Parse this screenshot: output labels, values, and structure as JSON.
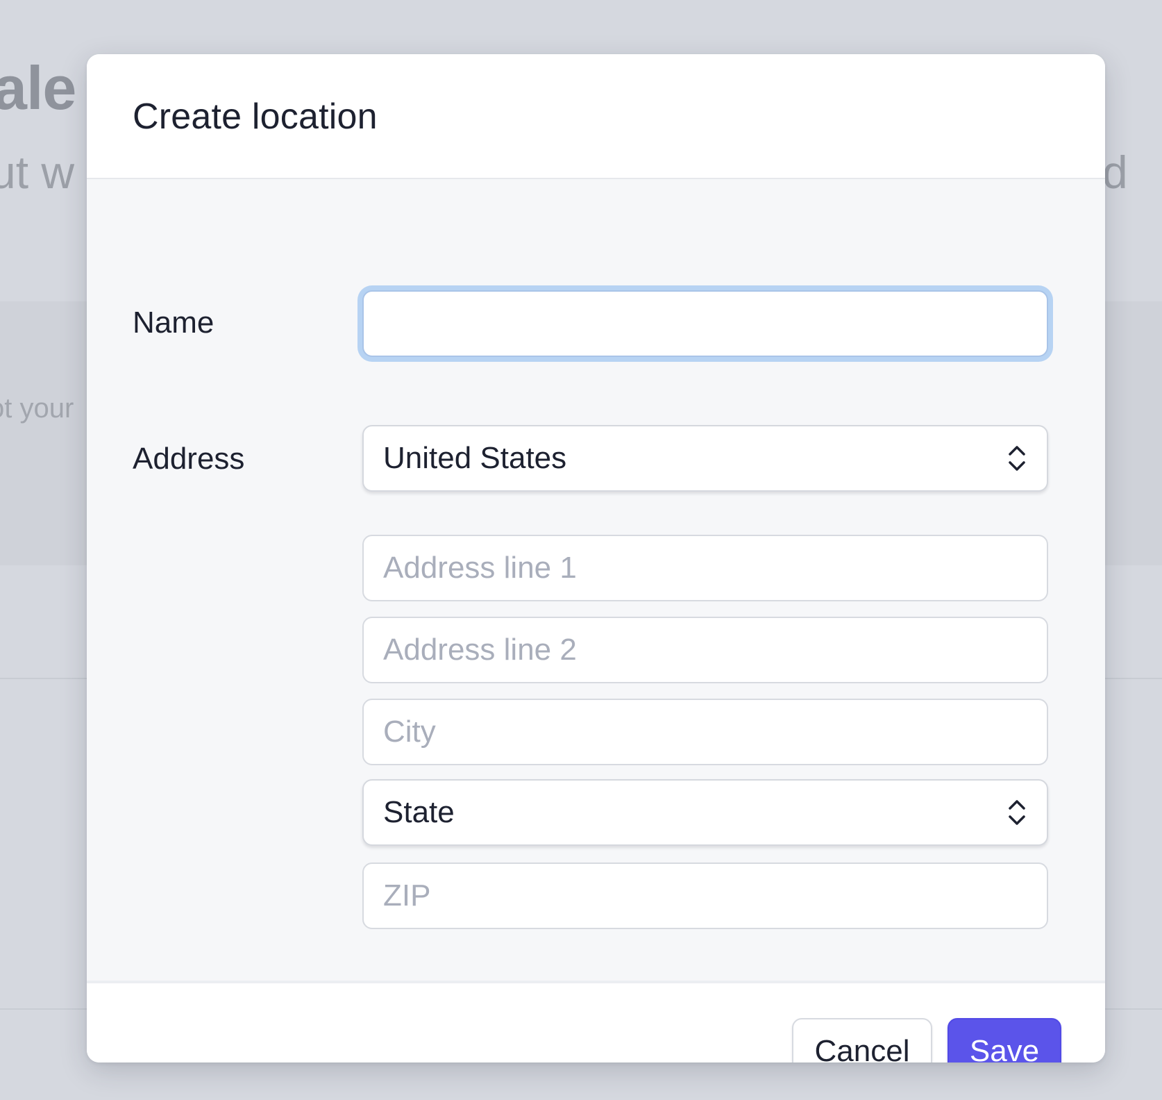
{
  "background": {
    "title_fragment": "ale",
    "subtitle_left_fragment": "ut w",
    "subtitle_right_fragment": "d",
    "hint_fragment": "ot your"
  },
  "modal": {
    "title": "Create location",
    "name": {
      "label": "Name",
      "value": "",
      "placeholder": ""
    },
    "address": {
      "label": "Address",
      "country": "United States",
      "line1_placeholder": "Address line 1",
      "line2_placeholder": "Address line 2",
      "city_placeholder": "City",
      "state": "State",
      "zip_placeholder": "ZIP"
    },
    "footer": {
      "cancel_label": "Cancel",
      "save_label": "Save"
    }
  },
  "colors": {
    "overlay": "#d5d8df",
    "primary": "#5b54ea",
    "focus_ring": "#b7d3f3"
  }
}
